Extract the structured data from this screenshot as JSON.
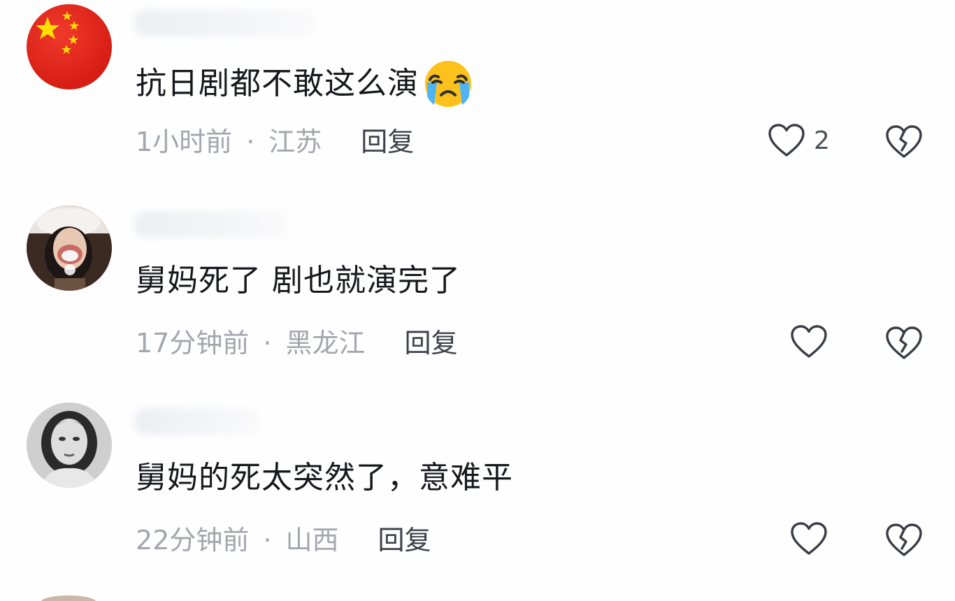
{
  "comments": [
    {
      "text": "抗日剧都不敢这么演",
      "emoji": "loudly-crying-face",
      "time": "1小时前",
      "separator": "·",
      "location": "江苏",
      "reply_label": "回复",
      "like_count": "2",
      "avatar": "china-flag-avatar"
    },
    {
      "text": "舅妈死了 剧也就演完了",
      "time": "17分钟前",
      "separator": "·",
      "location": "黑龙江",
      "reply_label": "回复",
      "like_count": "",
      "avatar": "girl-photo-avatar"
    },
    {
      "text": "舅妈的死太突然了，意难平",
      "time": "22分钟前",
      "separator": "·",
      "location": "山西",
      "reply_label": "回复",
      "like_count": "",
      "avatar": "woman-bw-photo-avatar"
    }
  ],
  "colors": {
    "text_primary": "#17181c",
    "text_secondary": "#a4a6ad",
    "reply": "#3e4048",
    "icon_stroke": "#3a3c44",
    "flag_red": "#e8231b",
    "flag_star": "#ffde00"
  }
}
